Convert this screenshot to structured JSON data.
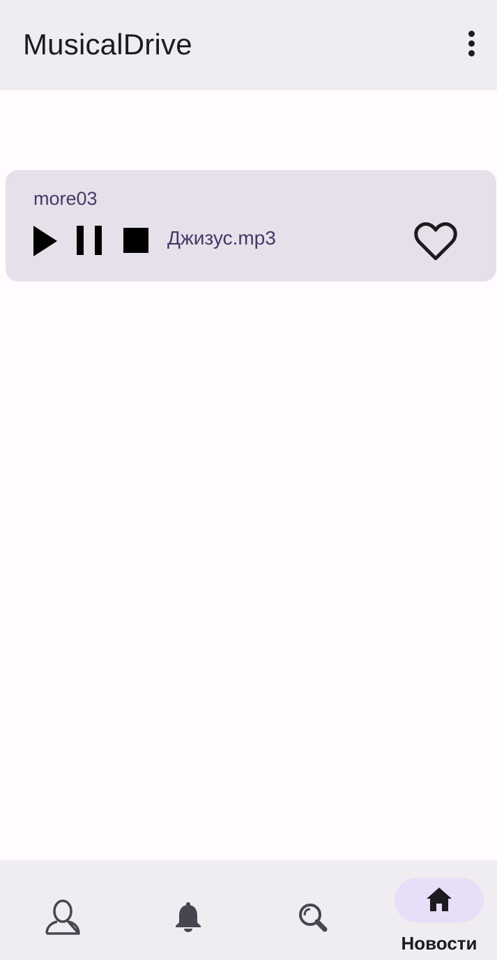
{
  "app_bar": {
    "title": "MusicalDrive",
    "overflow_icon": "more-vert-icon"
  },
  "track": {
    "author": "more03",
    "filename": "Джизус.mp3",
    "controls": {
      "play_icon": "play-icon",
      "pause_icon": "pause-icon",
      "stop_icon": "stop-icon",
      "like_icon": "heart-outline-icon"
    }
  },
  "bottom_nav": {
    "items": [
      {
        "icon": "person-outline-icon",
        "label": "",
        "selected": false
      },
      {
        "icon": "bell-icon",
        "label": "",
        "selected": false
      },
      {
        "icon": "search-icon",
        "label": "",
        "selected": false
      },
      {
        "icon": "home-icon",
        "label": "Новости",
        "selected": true
      }
    ]
  },
  "colors": {
    "app_bar_bg": "#efecf2",
    "background": "#fffbfe",
    "card_bg": "#e6e0ea",
    "accent_text": "#433a66",
    "selected_pill": "#e8def8"
  }
}
